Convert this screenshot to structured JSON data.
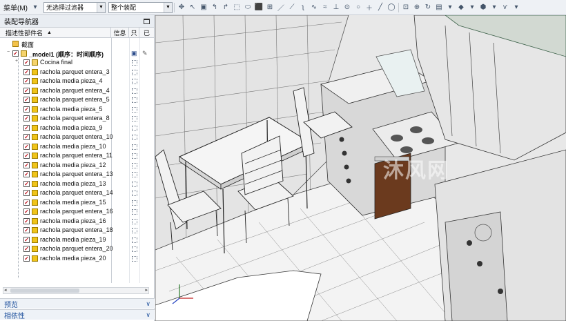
{
  "toolbar": {
    "menu_label": "菜单(M)",
    "filter_combo": "无选择过滤器",
    "scope_combo": "整个装配"
  },
  "navigator": {
    "title": "装配导航器",
    "columns": {
      "name": "描述性部件名",
      "info": "信息",
      "readonly": "只",
      "saved": "已"
    },
    "rows": [
      {
        "label": "截面",
        "type": "folder"
      },
      {
        "label": "_model1 (顺序：时间顺序)",
        "type": "root"
      },
      {
        "label": "Cocina final",
        "type": "assembly"
      },
      {
        "label": "rachola parquet entera_3",
        "type": "part"
      },
      {
        "label": "rachola media pieza_4",
        "type": "part"
      },
      {
        "label": "rachola parquet entera_4",
        "type": "part"
      },
      {
        "label": "rachola parquet entera_5",
        "type": "part"
      },
      {
        "label": "rachola media pieza_5",
        "type": "part"
      },
      {
        "label": "rachola parquet entera_8",
        "type": "part"
      },
      {
        "label": "rachola media pieza_9",
        "type": "part"
      },
      {
        "label": "rachola parquet entera_10",
        "type": "part"
      },
      {
        "label": "rachola media pieza_10",
        "type": "part"
      },
      {
        "label": "rachola parquet entera_11",
        "type": "part"
      },
      {
        "label": "rachola media pieza_12",
        "type": "part"
      },
      {
        "label": "rachola parquet entera_13",
        "type": "part"
      },
      {
        "label": "rachola media pieza_13",
        "type": "part"
      },
      {
        "label": "rachola parquet entera_14",
        "type": "part"
      },
      {
        "label": "rachola media pieza_15",
        "type": "part"
      },
      {
        "label": "rachola parquet entera_16",
        "type": "part"
      },
      {
        "label": "rachola media pieza_16",
        "type": "part"
      },
      {
        "label": "rachola parquet entera_18",
        "type": "part"
      },
      {
        "label": "rachola media pieza_19",
        "type": "part"
      },
      {
        "label": "rachola parquet entera_20",
        "type": "part"
      },
      {
        "label": "rachola media pieza_20",
        "type": "part"
      }
    ]
  },
  "sections": {
    "preview": "预览",
    "dependencies": "相依性"
  },
  "viewport": {
    "watermark": "沐风网"
  },
  "colors": {
    "accent": "#1d4f9c",
    "check": "#c0101a",
    "part_cube": "#e8b400"
  }
}
